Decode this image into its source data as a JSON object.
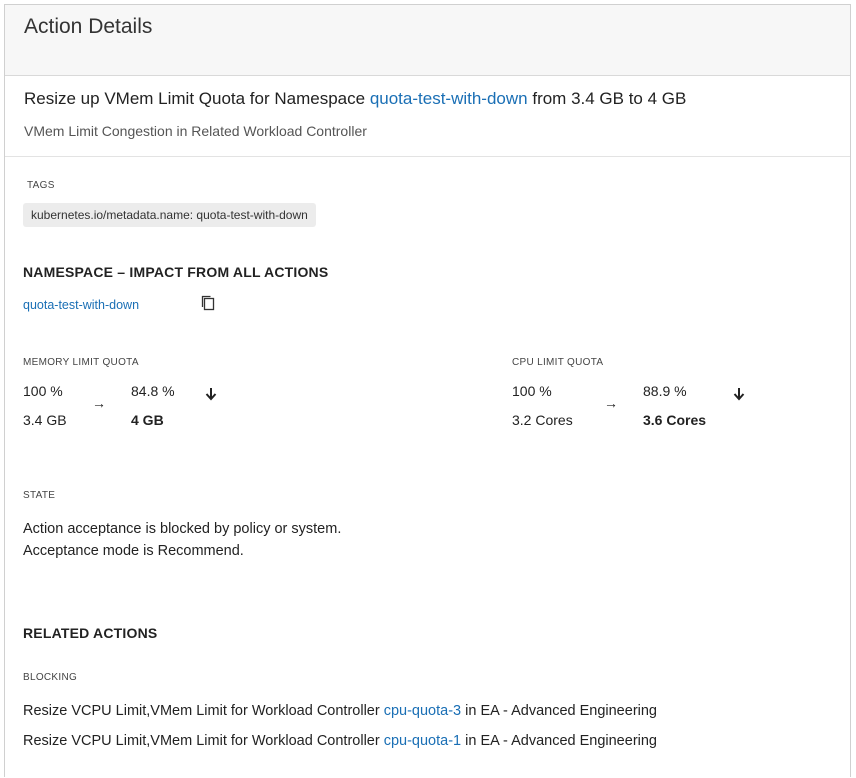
{
  "header": {
    "title": "Action Details"
  },
  "action": {
    "title_prefix": "Resize up VMem Limit Quota for Namespace ",
    "namespace_link": "quota-test-with-down",
    "title_suffix": " from 3.4 GB to 4 GB",
    "subtitle": "VMem Limit Congestion in Related Workload Controller"
  },
  "tags": {
    "label": "TAGS",
    "items": [
      "kubernetes.io/metadata.name: quota-test-with-down"
    ]
  },
  "namespace_impact": {
    "title": "NAMESPACE – IMPACT FROM ALL ACTIONS",
    "link": "quota-test-with-down",
    "copy_icon": "copy-icon"
  },
  "memory_quota": {
    "label": "MEMORY LIMIT QUOTA",
    "from_percent": "100 %",
    "from_value": "3.4 GB",
    "to_percent": "84.8 %",
    "to_value": "4 GB",
    "arrow": "→"
  },
  "cpu_quota": {
    "label": "CPU LIMIT QUOTA",
    "from_percent": "100 %",
    "from_value": "3.2 Cores",
    "to_percent": "88.9 %",
    "to_value": "3.6 Cores",
    "arrow": "→"
  },
  "state": {
    "label": "STATE",
    "line1": "Action acceptance is blocked by policy or system.",
    "line2": "Acceptance mode is Recommend."
  },
  "related_actions": {
    "title": "RELATED ACTIONS",
    "blocking_label": "BLOCKING",
    "items": [
      {
        "prefix": "Resize VCPU Limit,VMem Limit for Workload Controller ",
        "link": "cpu-quota-3",
        "suffix": " in EA - Advanced Engineering"
      },
      {
        "prefix": "Resize VCPU Limit,VMem Limit for Workload Controller ",
        "link": "cpu-quota-1",
        "suffix": " in EA - Advanced Engineering"
      }
    ]
  }
}
